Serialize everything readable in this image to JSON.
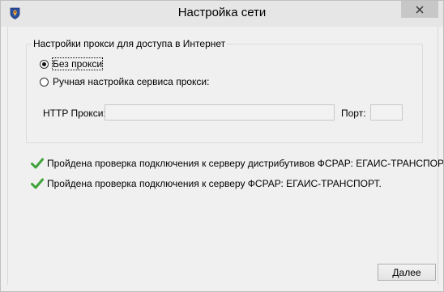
{
  "window": {
    "title": "Настройка сети",
    "close_icon": "close-x-icon",
    "app_icon": "coat-of-arms-icon"
  },
  "proxy": {
    "group_title": "Настройки прокси для доступа в Интернет",
    "options": [
      {
        "label": "Без прокси",
        "selected": true
      },
      {
        "label": "Ручная настройка сервиса прокси:",
        "selected": false
      }
    ],
    "http_label": "HTTP Прокси:",
    "http_value": "",
    "port_label": "Порт:",
    "port_value": ""
  },
  "status": [
    {
      "icon": "checkmark-icon",
      "text": "Пройдена проверка подключения к серверу дистрибутивов ФСРАР: ЕГАИС-ТРАНСПОРТ."
    },
    {
      "icon": "checkmark-icon",
      "text": "Пройдена проверка подключения к серверу ФСРАР: ЕГАИС-ТРАНСПОРТ."
    }
  ],
  "buttons": {
    "next_label": "Далее"
  },
  "colors": {
    "check_green": "#3fa33a",
    "titlebar_bg": "#e6e6e6",
    "window_bg": "#f0f0f0"
  }
}
